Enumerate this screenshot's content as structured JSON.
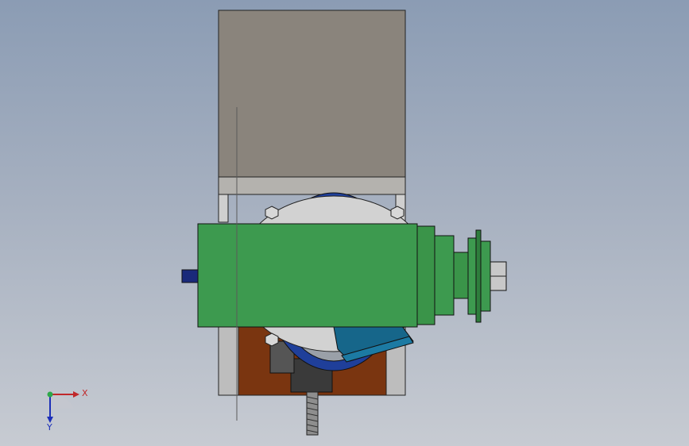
{
  "viewport": {
    "background": "gradient-gray-blue",
    "model": {
      "parts": [
        "top-block",
        "mount-plate",
        "green-motor-body",
        "blue-ring",
        "hex-nuts",
        "pulley",
        "bottom-bracket",
        "teal-lever",
        "threaded-rod",
        "shaft-stub"
      ],
      "colors": {
        "top_block": "#8a847c",
        "motor": "#3d9a4f",
        "motor_dark": "#2e7d3c",
        "plate": "#c9c9c9",
        "ring": "#1f3f9a",
        "bracket": "#7a3510",
        "lever": "#16668a",
        "shaft": "#1a2a7a"
      }
    }
  },
  "triad": {
    "x_label": "X",
    "y_label": "Y",
    "x_color": "#c0282a",
    "y_color": "#1c2fb8",
    "origin_color": "#2ea84a"
  }
}
